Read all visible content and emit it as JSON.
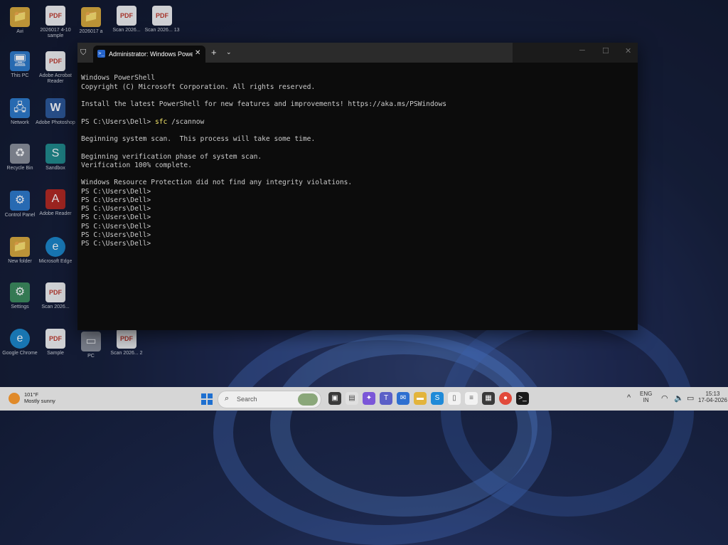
{
  "desktop": {
    "icons": [
      {
        "label": "Avi",
        "glyph": "📁"
      },
      {
        "label": "2026017 4-10 sample",
        "glyph": "PDF"
      },
      {
        "label": "2026017 a",
        "glyph": "📁"
      },
      {
        "label": "Scan 2026...",
        "glyph": "PDF"
      },
      {
        "label": "Scan 2026... 13",
        "glyph": "PDF"
      },
      {
        "label": "This PC",
        "glyph": "🖥"
      },
      {
        "label": "Adobe Acrobat Reader",
        "glyph": "PDF"
      },
      {
        "label": "Network",
        "glyph": "🖧"
      },
      {
        "label": "Adobe Photoshop",
        "glyph": "W"
      },
      {
        "label": "Recycle Bin",
        "glyph": "♻"
      },
      {
        "label": "Sandbox",
        "glyph": "S"
      },
      {
        "label": "Control Panel",
        "glyph": "⚙"
      },
      {
        "label": "Adobe Reader",
        "glyph": "A"
      },
      {
        "label": "New folder",
        "glyph": "📁"
      },
      {
        "label": "Microsoft Edge",
        "glyph": "e"
      },
      {
        "label": "Settings",
        "glyph": "⚙"
      },
      {
        "label": "Scan 2026...",
        "glyph": "PDF"
      },
      {
        "label": "Google Chrome",
        "glyph": "e"
      },
      {
        "label": "Sample",
        "glyph": "PDF"
      },
      {
        "label": "PC",
        "glyph": "▭"
      },
      {
        "label": "Scan 2026... 2",
        "glyph": "PDF"
      }
    ]
  },
  "terminal": {
    "tab_title": "Administrator: Windows PowerShell",
    "new_tab_symbol": "+",
    "dropdown_symbol": "⌄",
    "close_tab_symbol": "✕",
    "lines": {
      "l1": "Windows PowerShell",
      "l2": "Copyright (C) Microsoft Corporation. All rights reserved.",
      "l3": "",
      "l4": "Install the latest PowerShell for new features and improvements! https://aka.ms/PSWindows",
      "l5": "",
      "l6_prompt": "PS C:\\Users\\Dell> ",
      "l6_cmd": "sfc",
      "l6_arg": " /scannow",
      "l7": "",
      "l8": "Beginning system scan.  This process will take some time.",
      "l9": "",
      "l10": "Beginning verification phase of system scan.",
      "l11": "Verification 100% complete.",
      "l12": "",
      "l13": "Windows Resource Protection did not find any integrity violations.",
      "p1": "PS C:\\Users\\Dell>",
      "p2": "PS C:\\Users\\Dell>",
      "p3": "PS C:\\Users\\Dell>",
      "p4": "PS C:\\Users\\Dell>",
      "p5": "PS C:\\Users\\Dell>",
      "p6": "PS C:\\Users\\Dell>",
      "p7": "PS C:\\Users\\Dell>"
    }
  },
  "taskbar": {
    "weather_temp": "101°F",
    "weather_desc": "Mostly sunny",
    "search_placeholder": "Search",
    "lang_line1": "ENG",
    "lang_line2": "IN",
    "time": "15:13",
    "date": "17-04-2026"
  }
}
